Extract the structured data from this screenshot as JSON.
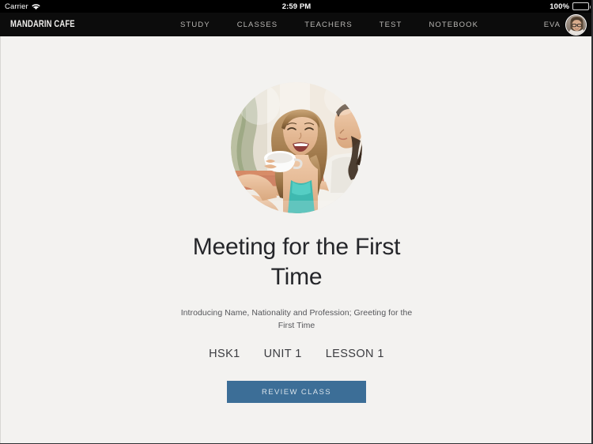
{
  "statusbar": {
    "carrier": "Carrier",
    "wifi_icon": "wifi-icon",
    "time": "2:59 PM",
    "battery_percent": "100%",
    "battery_icon": "battery-icon"
  },
  "navbar": {
    "brand": "MANDARIN CAFE",
    "links": [
      {
        "label": "STUDY"
      },
      {
        "label": "CLASSES"
      },
      {
        "label": "TEACHERS"
      },
      {
        "label": "TEST"
      },
      {
        "label": "NOTEBOOK"
      }
    ],
    "user": {
      "name": "EVA",
      "avatar_icon": "user-avatar"
    }
  },
  "main": {
    "hero_image": "lesson-hero-photo",
    "title": "Meeting for the First Time",
    "subtitle": "Introducing Name, Nationality and Profession; Greeting for the First Time",
    "meta": [
      {
        "label": "HSK1"
      },
      {
        "label": "UNIT 1"
      },
      {
        "label": "LESSON 1"
      }
    ],
    "review_button": "REVIEW CLASS"
  },
  "colors": {
    "navbar_background": "#0c0c0c",
    "page_background": "#f3f2f0",
    "button_background": "#3c6e97",
    "button_text": "#d7e2ea",
    "title_text": "#25262a",
    "subtitle_text": "#55565a",
    "nav_link_text": "#b9b7b4"
  }
}
